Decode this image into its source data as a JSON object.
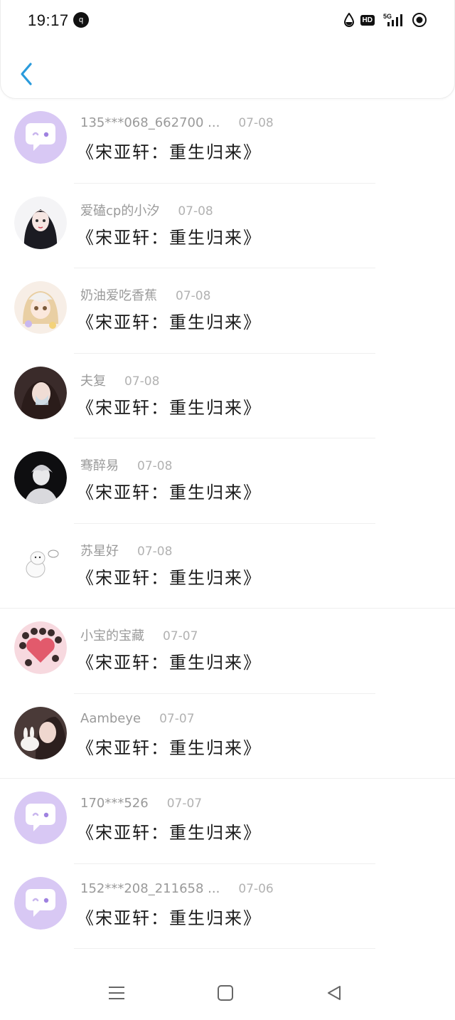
{
  "status_bar": {
    "time": "19:17",
    "notification_badge": "q",
    "hd": "HD",
    "network": "5G",
    "icons": [
      "water-drop-icon",
      "hd-icon",
      "signal-5g-icon",
      "record-icon"
    ]
  },
  "header": {
    "back_icon": "chevron-left-icon",
    "accent": "#2a9bdc"
  },
  "items": [
    {
      "user": "135***068_662700 ...",
      "date": "07-08",
      "title": "《宋亚轩：重生归来》",
      "avatar": "default-chat-avatar"
    },
    {
      "user": "爱磕cp的小汐",
      "date": "07-08",
      "title": "《宋亚轩：重生归来》",
      "avatar": "girl-illustration-avatar"
    },
    {
      "user": "奶油爱吃香蕉",
      "date": "07-08",
      "title": "《宋亚轩：重生归来》",
      "avatar": "anime-girl-avatar"
    },
    {
      "user": "夫复",
      "date": "07-08",
      "title": "《宋亚轩：重生归来》",
      "avatar": "photo-girl-avatar"
    },
    {
      "user": "骞醉易",
      "date": "07-08",
      "title": "《宋亚轩：重生归来》",
      "avatar": "anime-boy-avatar"
    },
    {
      "user": "苏星好",
      "date": "07-08",
      "title": "《宋亚轩：重生归来》",
      "avatar": "white-dog-avatar"
    },
    {
      "user": "小宝的宝藏",
      "date": "07-07",
      "title": "《宋亚轩：重生归来》",
      "avatar": "cartoon-heart-avatar"
    },
    {
      "user": "Aambeye",
      "date": "07-07",
      "title": "《宋亚轩：重生归来》",
      "avatar": "photo-rabbit-avatar"
    },
    {
      "user": "170***526",
      "date": "07-07",
      "title": "《宋亚轩：重生归来》",
      "avatar": "default-chat-avatar"
    },
    {
      "user": "152***208_211658 ...",
      "date": "07-06",
      "title": "《宋亚轩：重生归来》",
      "avatar": "default-chat-avatar"
    }
  ],
  "nav_bar": {
    "icons": [
      "menu-icon",
      "home-square-icon",
      "back-triangle-icon"
    ]
  },
  "colors": {
    "default_avatar_bg": "#d8c8f4",
    "username": "#9a9a9a",
    "date": "#b2b2b2",
    "title": "#1a1a1a"
  }
}
